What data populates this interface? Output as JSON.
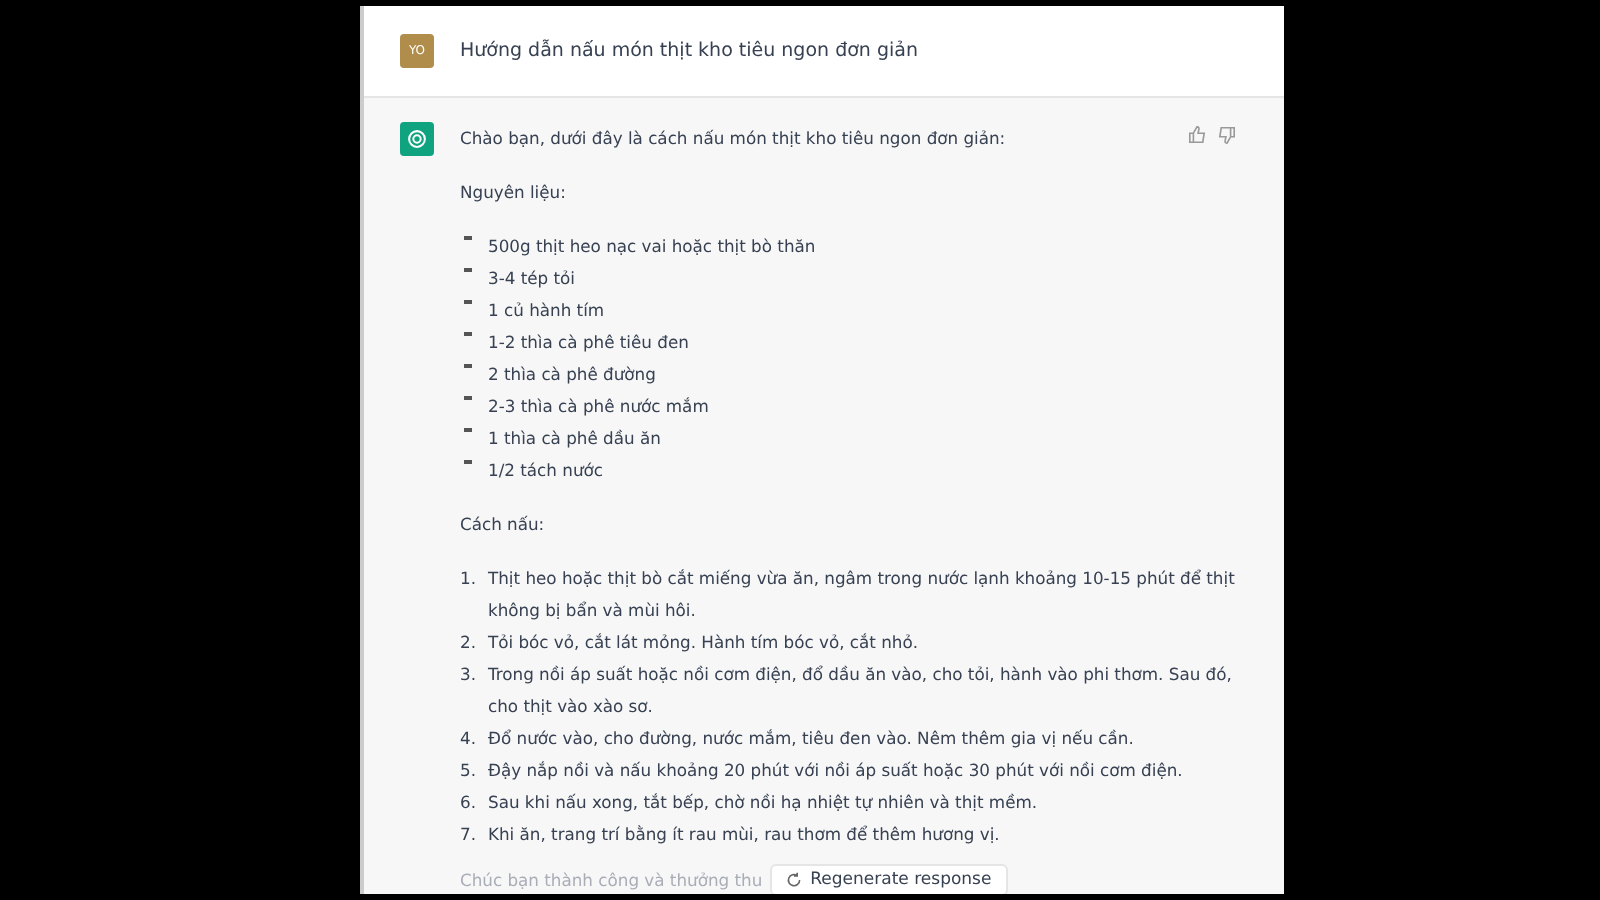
{
  "user_message": {
    "avatar": "YO",
    "text": "Hướng dẫn nấu món thịt kho tiêu ngon đơn giản"
  },
  "assistant_message": {
    "intro": "Chào bạn, dưới đây là cách nấu món thịt kho tiêu ngon đơn giản:",
    "ingredients_heading": "Nguyên liệu:",
    "ingredients": [
      "500g thịt heo nạc vai hoặc thịt bò thăn",
      "3-4 tép tỏi",
      "1 củ hành tím",
      "1-2 thìa cà phê tiêu đen",
      "2 thìa cà phê đường",
      "2-3 thìa cà phê nước mắm",
      "1 thìa cà phê dầu ăn",
      "1/2 tách nước"
    ],
    "steps_heading": "Cách nấu:",
    "steps": [
      {
        "number": "1.",
        "text": "Thịt heo hoặc thịt bò cắt miếng vừa ăn, ngâm trong nước lạnh khoảng 10-15 phút để thịt không bị bẩn và mùi hôi."
      },
      {
        "number": "2.",
        "text": "Tỏi bóc vỏ, cắt lát mỏng. Hành tím bóc vỏ, cắt nhỏ."
      },
      {
        "number": "3.",
        "text": "Trong nồi áp suất hoặc nồi cơm điện, đổ dầu ăn vào, cho tỏi, hành vào phi thơm. Sau đó, cho thịt vào xào sơ."
      },
      {
        "number": "4.",
        "text": "Đổ nước vào, cho đường, nước mắm, tiêu đen vào. Nêm thêm gia vị nếu cần."
      },
      {
        "number": "5.",
        "text": "Đậy nắp nồi và nấu khoảng 20 phút với nồi áp suất hoặc 30 phút với nồi cơm điện."
      },
      {
        "number": "6.",
        "text": "Sau khi nấu xong, tắt bếp, chờ nồi hạ nhiệt tự nhiên và thịt mềm."
      },
      {
        "number": "7.",
        "text": "Khi ăn, trang trí bằng ít rau mùi, rau thơm để thêm hương vị."
      }
    ],
    "closing": "Chúc bạn thành công và thưởng thu"
  },
  "regenerate_button": {
    "label": "Regenerate response"
  }
}
